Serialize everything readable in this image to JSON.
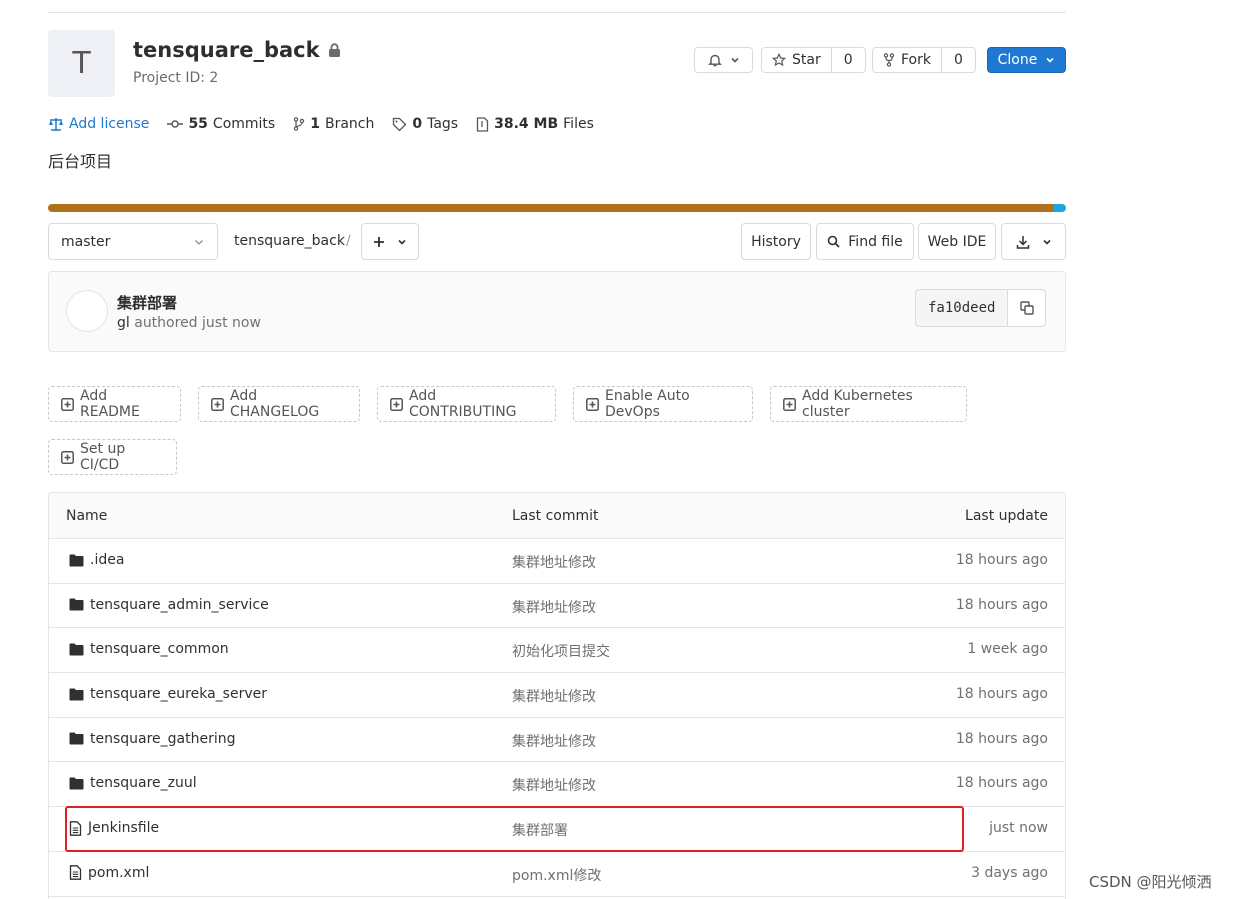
{
  "project": {
    "avatar_letter": "T",
    "name": "tensquare_back",
    "id_text": "Project ID: 2",
    "description": "后台项目"
  },
  "actions": {
    "star_label": "Star",
    "star_count": "0",
    "fork_label": "Fork",
    "fork_count": "0",
    "clone_label": "Clone"
  },
  "stats": {
    "license": "Add license",
    "commits_count": "55",
    "commits_label": "Commits",
    "branch_count": "1",
    "branch_label": "Branch",
    "tags_count": "0",
    "tags_label": "Tags",
    "files_size": "38.4 MB",
    "files_label": "Files"
  },
  "language_colors": [
    "#b07219",
    "#1aa7e0"
  ],
  "nav": {
    "branch": "master",
    "breadcrumb": "tensquare_back",
    "separator": "/",
    "history": "History",
    "find_file": "Find file",
    "web_ide": "Web IDE"
  },
  "last_commit": {
    "title": "集群部署",
    "author": "gl",
    "meta": "authored just now",
    "sha": "fa10deed"
  },
  "quick_actions": [
    "Add README",
    "Add CHANGELOG",
    "Add CONTRIBUTING",
    "Enable Auto DevOps",
    "Add Kubernetes cluster",
    "Set up CI/CD"
  ],
  "table": {
    "headers": [
      "Name",
      "Last commit",
      "Last update"
    ],
    "rows": [
      {
        "type": "folder",
        "name": ".idea",
        "commit": "集群地址修改",
        "updated": "18 hours ago"
      },
      {
        "type": "folder",
        "name": "tensquare_admin_service",
        "commit": "集群地址修改",
        "updated": "18 hours ago"
      },
      {
        "type": "folder",
        "name": "tensquare_common",
        "commit": "初始化项目提交",
        "updated": "1 week ago"
      },
      {
        "type": "folder",
        "name": "tensquare_eureka_server",
        "commit": "集群地址修改",
        "updated": "18 hours ago"
      },
      {
        "type": "folder",
        "name": "tensquare_gathering",
        "commit": "集群地址修改",
        "updated": "18 hours ago"
      },
      {
        "type": "folder",
        "name": "tensquare_zuul",
        "commit": "集群地址修改",
        "updated": "18 hours ago"
      },
      {
        "type": "file",
        "name": "Jenkinsfile",
        "commit": "集群部署",
        "updated": "just now"
      },
      {
        "type": "file",
        "name": "pom.xml",
        "commit": "pom.xml修改",
        "updated": "3 days ago"
      }
    ]
  },
  "annotation": {
    "highlight_color": "#e02020"
  },
  "watermark": "CSDN @阳光倾洒"
}
